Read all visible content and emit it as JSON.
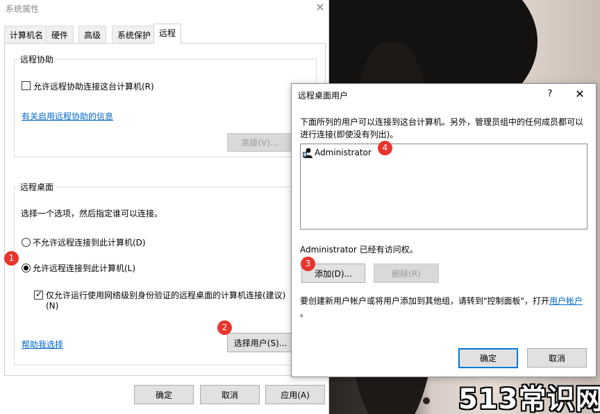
{
  "system_properties": {
    "title": "系统属性",
    "close_glyph": "✕",
    "tabs": [
      {
        "label": "计算机名",
        "active": false
      },
      {
        "label": "硬件",
        "active": false
      },
      {
        "label": "高级",
        "active": false
      },
      {
        "label": "系统保护",
        "active": false
      },
      {
        "label": "远程",
        "active": true
      }
    ],
    "remote_assistance": {
      "group_label": "远程协助",
      "allow_checkbox_label": "允许远程协助连接这台计算机(R)",
      "allow_checked": false,
      "info_link": "有关启用远程协助的信息",
      "advanced_button": "高级(V)..."
    },
    "remote_desktop": {
      "group_label": "远程桌面",
      "instruction": "选择一个选项，然后指定谁可以连接。",
      "option_deny": "不允许远程连接到此计算机(D)",
      "option_allow": "允许远程连接到此计算机(L)",
      "selected_option": "allow",
      "nla_label_line1": "仅允许运行使用网络级别身份验证的远程桌面的计算机连接(建议)",
      "nla_label_line2": "(N)",
      "nla_checked": true,
      "help_link": "帮助我选择",
      "select_users_button": "选择用户(S)..."
    },
    "buttons": {
      "ok": "确定",
      "cancel": "取消",
      "apply": "应用(A)"
    }
  },
  "remote_desktop_users_dialog": {
    "title": "远程桌面用户",
    "help_glyph": "?",
    "close_glyph": "✕",
    "description": "下面所列的用户可以连接到这台计算机。另外，管理员组中的任何成员都可以进行连接(即使没有列出)。",
    "users": [
      "Administrator"
    ],
    "access_note": "Administrator 已经有访问权。",
    "add_button": "添加(D)...",
    "remove_button": "删除(R)",
    "note_text": "要创建新用户帐户或将用户添加到其他组，请转到\"控制面板\"，打开",
    "note_link": "用户帐户",
    "note_end": "。",
    "ok_button": "确定",
    "cancel_button": "取消"
  },
  "annotations": {
    "badge1": "1",
    "badge2": "2",
    "badge3": "3",
    "badge4": "4"
  },
  "watermark": "513常识网",
  "colors": {
    "badge": "#e8352e",
    "link": "#0066cc",
    "default_button_border": "#0078d7"
  }
}
